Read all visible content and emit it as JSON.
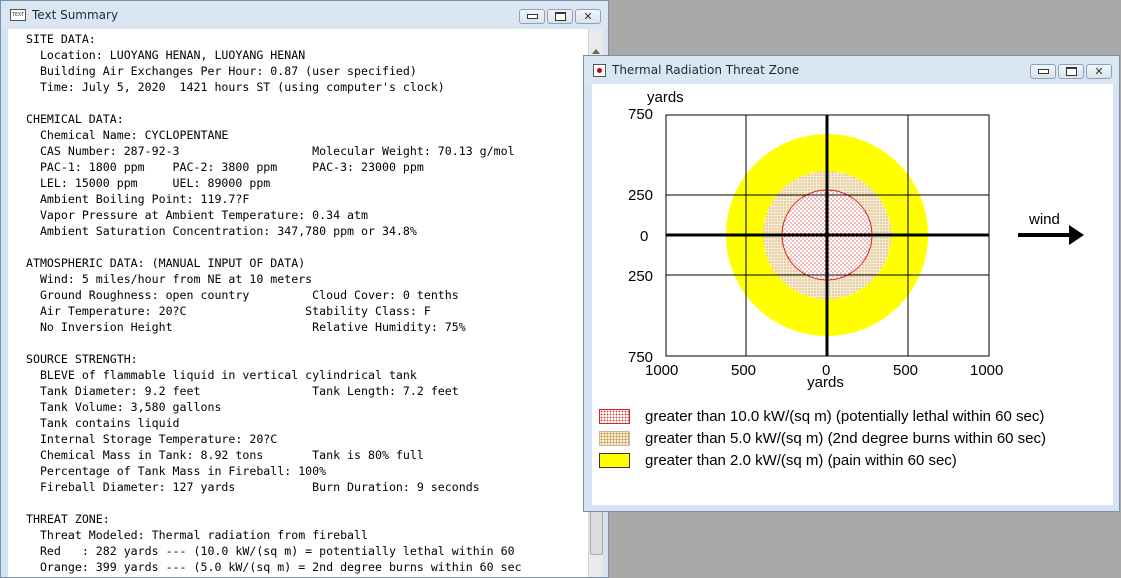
{
  "text_window": {
    "title": "Text Summary",
    "icon": "TEXT",
    "lines": [
      " SITE DATA:",
      "   Location: LUOYANG HENAN, LUOYANG HENAN",
      "   Building Air Exchanges Per Hour: 0.87 (user specified)",
      "   Time: July 5, 2020  1421 hours ST (using computer's clock)",
      "",
      " CHEMICAL DATA:",
      "   Chemical Name: CYCLOPENTANE",
      "   CAS Number: 287-92-3                   Molecular Weight: 70.13 g/mol",
      "   PAC-1: 1800 ppm    PAC-2: 3800 ppm     PAC-3: 23000 ppm",
      "   LEL: 15000 ppm     UEL: 89000 ppm",
      "   Ambient Boiling Point: 119.7?F",
      "   Vapor Pressure at Ambient Temperature: 0.34 atm",
      "   Ambient Saturation Concentration: 347,780 ppm or 34.8%",
      "",
      " ATMOSPHERIC DATA: (MANUAL INPUT OF DATA)",
      "   Wind: 5 miles/hour from NE at 10 meters",
      "   Ground Roughness: open country         Cloud Cover: 0 tenths",
      "   Air Temperature: 20?C                 Stability Class: F",
      "   No Inversion Height                    Relative Humidity: 75%",
      "",
      " SOURCE STRENGTH:",
      "   BLEVE of flammable liquid in vertical cylindrical tank",
      "   Tank Diameter: 9.2 feet                Tank Length: 7.2 feet",
      "   Tank Volume: 3,580 gallons",
      "   Tank contains liquid",
      "   Internal Storage Temperature: 20?C",
      "   Chemical Mass in Tank: 8.92 tons       Tank is 80% full",
      "   Percentage of Tank Mass in Fireball: 100%",
      "   Fireball Diameter: 127 yards           Burn Duration: 9 seconds",
      "",
      " THREAT ZONE:",
      "   Threat Modeled: Thermal radiation from fireball",
      "   Red   : 282 yards --- (10.0 kW/(sq m) = potentially lethal within 60",
      "   Orange: 399 yards --- (5.0 kW/(sq m) = 2nd degree burns within 60 sec"
    ]
  },
  "threat_window": {
    "title": "Thermal Radiation Threat Zone",
    "y_unit": "yards",
    "x_unit": "yards",
    "y_ticks": [
      "750",
      "250",
      "0",
      "250",
      "750"
    ],
    "x_ticks": [
      "1000",
      "500",
      "0",
      "500",
      "1000"
    ],
    "wind_label": "wind",
    "legend": [
      {
        "label": "greater than 10.0 kW/(sq m) (potentially lethal within 60 sec)",
        "color": "#e02020"
      },
      {
        "label": "greater than 5.0 kW/(sq m) (2nd degree burns within 60 sec)",
        "color": "#f6e8c8"
      },
      {
        "label": "greater than 2.0 kW/(sq m) (pain within 60 sec)",
        "color": "#ffff00"
      }
    ]
  }
}
